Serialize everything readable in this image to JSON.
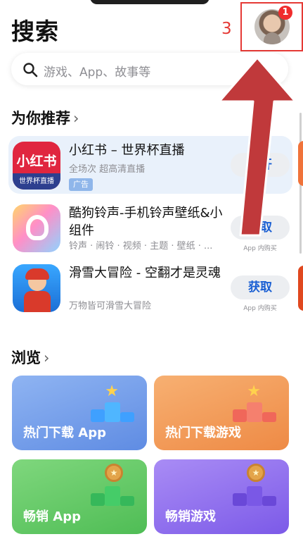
{
  "header": {
    "title": "搜索",
    "step_number": "3",
    "avatar_badge": "1"
  },
  "search": {
    "placeholder": "游戏、App、故事等"
  },
  "recommend": {
    "title": "为你推荐",
    "chevron": "›",
    "apps": [
      {
        "name": "小红书 – 世界杯直播",
        "subtitle": "全场次 超高清直播",
        "tag": "广告",
        "action": "打开",
        "icon": "xiaohongshu-icon",
        "icon_text": "小红书",
        "icon_banner": "世界杯直播"
      },
      {
        "name": "酷狗铃声-手机铃声壁纸&小组件",
        "subtitle": "铃声 · 闹铃 · 视频 · 主题 · 壁纸 · ...",
        "action": "获取",
        "note": "App 内购买",
        "icon": "kugou-ringtone-icon"
      },
      {
        "name": "滑雪大冒险 - 空翻才是灵魂",
        "subtitle": "万物皆可滑雪大冒险",
        "action": "获取",
        "note": "App 内购买",
        "icon": "ski-safari-icon"
      }
    ]
  },
  "browse": {
    "title": "浏览",
    "chevron": "›",
    "tiles": [
      {
        "label": "热门下载 App",
        "color": "#6b98e8",
        "icon": "star-podium-icon"
      },
      {
        "label": "热门下载游戏",
        "color": "#f0924a",
        "icon": "star-podium-icon"
      },
      {
        "label": "畅销 App",
        "color": "#5ec45f",
        "icon": "medal-podium-icon"
      },
      {
        "label": "畅销游戏",
        "color": "#8f6cf0",
        "icon": "medal-podium-icon"
      }
    ]
  },
  "annotation": {
    "arrow_color": "#c0393b",
    "box_color": "#e53935"
  }
}
